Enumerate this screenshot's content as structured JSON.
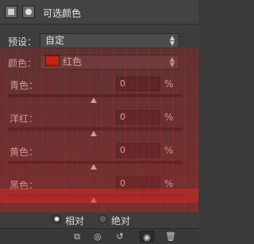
{
  "header": {
    "title": "可选颜色",
    "icons": [
      "adjustment-layer-icon",
      "mask-icon"
    ]
  },
  "preset": {
    "label": "预设：",
    "value": "自定"
  },
  "colors": {
    "label": "颜色：",
    "value": "红色",
    "swatch": "#d42a0a"
  },
  "sliders": [
    {
      "label": "青色：",
      "value": "0",
      "unit": "%"
    },
    {
      "label": "洋红：",
      "value": "0",
      "unit": "%"
    },
    {
      "label": "黄色：",
      "value": "0",
      "unit": "%"
    },
    {
      "label": "黑色：",
      "value": "0",
      "unit": "%"
    }
  ],
  "mode": {
    "options": [
      "相对",
      "绝对"
    ],
    "selected": "相对"
  },
  "toolbar": {
    "icons": [
      "clip-icon",
      "view-previous-icon",
      "reset-icon",
      "visibility-icon",
      "trash-icon"
    ]
  }
}
